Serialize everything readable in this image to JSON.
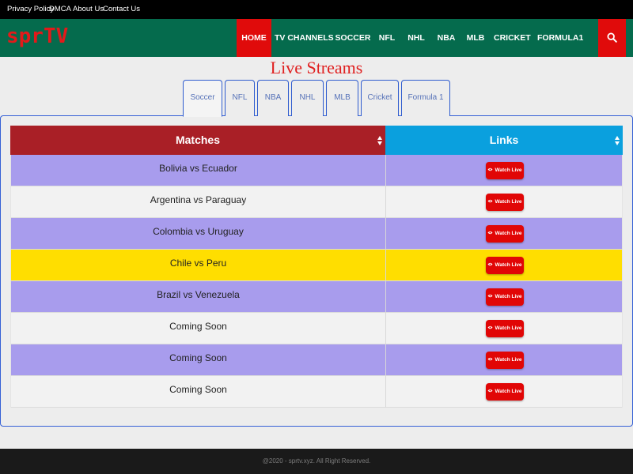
{
  "topbar": {
    "links": [
      "Privacy Policy",
      "DMCA",
      "About Us",
      "Contact Us"
    ]
  },
  "navbar": {
    "logo": "sprTV",
    "items": [
      "HOME",
      "TV CHANNELS",
      "SOCCER",
      "NFL",
      "NHL",
      "NBA",
      "MLB",
      "CRICKET",
      "FORMULA1"
    ],
    "active": "HOME",
    "search_icon": "search-icon"
  },
  "main": {
    "title": "Live Streams",
    "tabs": [
      "Soccer",
      "NFL",
      "NBA",
      "NHL",
      "MLB",
      "Cricket",
      "Formula 1"
    ],
    "active_tab": "Soccer"
  },
  "table": {
    "headers": {
      "matches": "Matches",
      "links": "Links"
    },
    "button_label": "Watch Live",
    "rows": [
      {
        "match": "Bolivia vs Ecuador",
        "bg": "#a89ced"
      },
      {
        "match": "Argentina vs Paraguay",
        "bg": "#f2f2f2"
      },
      {
        "match": "Colombia vs Uruguay",
        "bg": "#a89ced"
      },
      {
        "match": "Chile vs Peru",
        "bg": "#ffde00"
      },
      {
        "match": "Brazil vs Venezuela",
        "bg": "#a89ced"
      },
      {
        "match": "Coming Soon",
        "bg": "#f2f2f2"
      },
      {
        "match": "Coming Soon",
        "bg": "#a89ced"
      },
      {
        "match": "Coming Soon",
        "bg": "#f2f2f2"
      }
    ]
  },
  "footer": {
    "text": "@2020 - sprtv.xyz. All Right Reserved."
  },
  "colors": {
    "navbar": "#056b4d",
    "accent_red": "#e00b0b",
    "matches_header": "#a91f26",
    "links_header": "#0aa0de"
  }
}
